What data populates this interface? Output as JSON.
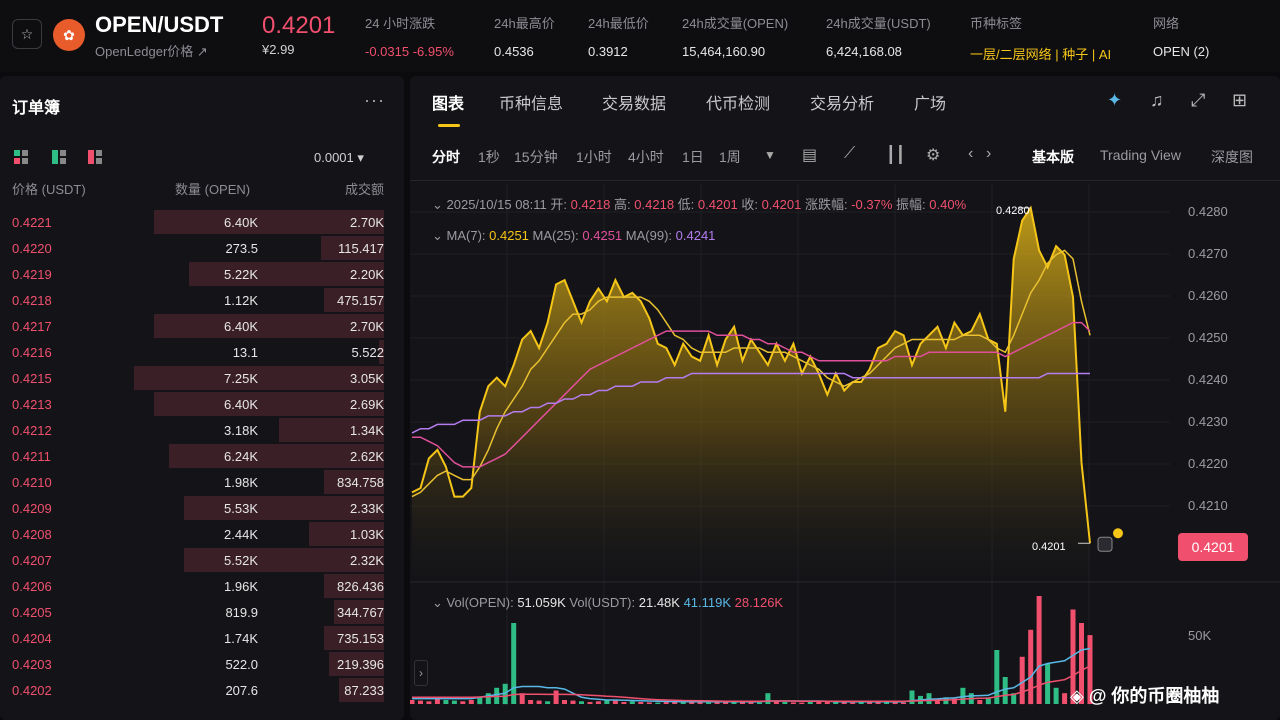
{
  "header": {
    "favorite_icon": "star-icon",
    "coin_icon": "openledger-logo-icon",
    "pair": "OPEN/USDT",
    "coin_name": "OpenLedger价格 ↗",
    "last_price": "0.4201",
    "cny_price": "¥2.99",
    "stats": [
      {
        "label": "24 小时涨跌",
        "value": "-0.0315 -6.95%",
        "style": "red"
      },
      {
        "label": "24h最高价",
        "value": "0.4536",
        "style": ""
      },
      {
        "label": "24h最低价",
        "value": "0.3912",
        "style": ""
      },
      {
        "label": "24h成交量(OPEN)",
        "value": "15,464,160.90",
        "style": ""
      },
      {
        "label": "24h成交量(USDT)",
        "value": "6,424,168.08",
        "style": ""
      },
      {
        "label": "币种标签",
        "value": "一层/二层网络 | 种子 | AI",
        "style": "gold"
      },
      {
        "label": "网络",
        "value": "OPEN (2)",
        "style": ""
      }
    ]
  },
  "orderbook": {
    "title": "订单簿",
    "more_icon": "more-icon",
    "precision": "0.0001 ▾",
    "headers": {
      "price": "价格 (USDT)",
      "qty": "数量 (OPEN)",
      "total": "成交额"
    },
    "rows": [
      {
        "price": "0.4221",
        "qty": "6.40K",
        "total": "2.70K",
        "depth": 0.92
      },
      {
        "price": "0.4220",
        "qty": "273.5",
        "total": "115.417",
        "depth": 0.25
      },
      {
        "price": "0.4219",
        "qty": "5.22K",
        "total": "2.20K",
        "depth": 0.78
      },
      {
        "price": "0.4218",
        "qty": "1.12K",
        "total": "475.157",
        "depth": 0.24
      },
      {
        "price": "0.4217",
        "qty": "6.40K",
        "total": "2.70K",
        "depth": 0.92
      },
      {
        "price": "0.4216",
        "qty": "13.1",
        "total": "5.522",
        "depth": 0.02
      },
      {
        "price": "0.4215",
        "qty": "7.25K",
        "total": "3.05K",
        "depth": 1.0
      },
      {
        "price": "0.4213",
        "qty": "6.40K",
        "total": "2.69K",
        "depth": 0.92
      },
      {
        "price": "0.4212",
        "qty": "3.18K",
        "total": "1.34K",
        "depth": 0.42
      },
      {
        "price": "0.4211",
        "qty": "6.24K",
        "total": "2.62K",
        "depth": 0.86
      },
      {
        "price": "0.4210",
        "qty": "1.98K",
        "total": "834.758",
        "depth": 0.24
      },
      {
        "price": "0.4209",
        "qty": "5.53K",
        "total": "2.33K",
        "depth": 0.8
      },
      {
        "price": "0.4208",
        "qty": "2.44K",
        "total": "1.03K",
        "depth": 0.3
      },
      {
        "price": "0.4207",
        "qty": "5.52K",
        "total": "2.32K",
        "depth": 0.8
      },
      {
        "price": "0.4206",
        "qty": "1.96K",
        "total": "826.436",
        "depth": 0.24
      },
      {
        "price": "0.4205",
        "qty": "819.9",
        "total": "344.767",
        "depth": 0.2
      },
      {
        "price": "0.4204",
        "qty": "1.74K",
        "total": "735.153",
        "depth": 0.24
      },
      {
        "price": "0.4203",
        "qty": "522.0",
        "total": "219.396",
        "depth": 0.22
      },
      {
        "price": "0.4202",
        "qty": "207.6",
        "total": "87.233",
        "depth": 0.18
      }
    ]
  },
  "tabs": [
    {
      "label": "图表",
      "active": true
    },
    {
      "label": "币种信息",
      "active": false
    },
    {
      "label": "交易数据",
      "active": false
    },
    {
      "label": "代币检测",
      "active": false
    },
    {
      "label": "交易分析",
      "active": false
    },
    {
      "label": "广场",
      "active": false
    }
  ],
  "tab_icons": [
    "sparkle-icon",
    "bell-icon",
    "expand-icon",
    "grid-icon"
  ],
  "intervals": [
    {
      "label": "分时",
      "active": true
    },
    {
      "label": "1秒",
      "active": false
    },
    {
      "label": "15分钟",
      "active": false
    },
    {
      "label": "1小时",
      "active": false
    },
    {
      "label": "4小时",
      "active": false
    },
    {
      "label": "1日",
      "active": false
    },
    {
      "label": "1周",
      "active": false
    }
  ],
  "tools": [
    "dropdown-icon",
    "calendar-icon",
    "indicator-icon",
    "candle-icon",
    "settings-icon",
    "prev-icon",
    "next-icon"
  ],
  "views": [
    {
      "label": "基本版",
      "active": true
    },
    {
      "label": "Trading View",
      "active": false
    },
    {
      "label": "深度图",
      "active": false
    }
  ],
  "ohlc": {
    "date": "2025/10/15 08:11",
    "open_label": "开:",
    "open": "0.4218",
    "high_label": "高:",
    "high": "0.4218",
    "low_label": "低:",
    "low": "0.4201",
    "close_label": "收:",
    "close": "0.4201",
    "chg_label": "涨跌幅:",
    "chg": "-0.37%",
    "amp_label": "振幅:",
    "amp": "0.40%"
  },
  "ma": {
    "ma7_label": "MA(7):",
    "ma7": "0.4251",
    "ma25_label": "MA(25):",
    "ma25": "0.4251",
    "ma99_label": "MA(99):",
    "ma99": "0.4241"
  },
  "vol": {
    "open_label": "Vol(OPEN):",
    "open": "51.059K",
    "usdt_label": "Vol(USDT):",
    "usdt": "21.48K",
    "ma1": "41.119K",
    "ma2": "28.126K"
  },
  "colors": {
    "accent": "#f5c518",
    "down": "#f0506e",
    "up": "#2ebd85",
    "ma25": "#e0509a",
    "ma99": "#b57cf0",
    "volma": "#5ab8e6"
  },
  "chart_data": {
    "type": "area",
    "ylim": [
      0.4198,
      0.4284
    ],
    "yticks": [
      "0.4280",
      "0.4270",
      "0.4260",
      "0.4250",
      "0.4240",
      "0.4230",
      "0.4220",
      "0.4210"
    ],
    "current_price": "0.4201",
    "high_marker": "0.4280",
    "low_marker": "0.4201",
    "series": [
      {
        "values": [
          0.4213,
          0.4214,
          0.4221,
          0.4223,
          0.4219,
          0.4212,
          0.4212,
          0.4214,
          0.4232,
          0.4238,
          0.424,
          0.4238,
          0.4243,
          0.4249,
          0.4251,
          0.4247,
          0.4253,
          0.4262,
          0.4263,
          0.4258,
          0.4253,
          0.4258,
          0.4261,
          0.4258,
          0.4263,
          0.4259,
          0.426,
          0.4258,
          0.4254,
          0.4248,
          0.4247,
          0.4243,
          0.4248,
          0.4245,
          0.4244,
          0.425,
          0.4243,
          0.4249,
          0.4252,
          0.4244,
          0.4249,
          0.4246,
          0.4243,
          0.4248,
          0.4244,
          0.4248,
          0.4241,
          0.4245,
          0.4241,
          0.4236,
          0.4241,
          0.4237,
          0.4239,
          0.4239,
          0.4242,
          0.4247,
          0.4248,
          0.4251,
          0.425,
          0.4243,
          0.4248,
          0.425,
          0.4252,
          0.4247,
          0.4253,
          0.425,
          0.4251,
          0.4255,
          0.4249,
          0.4248,
          0.4232,
          0.4268,
          0.4277,
          0.428,
          0.427,
          0.4266,
          0.4271,
          0.4269,
          0.4259,
          0.422,
          0.4201
        ]
      }
    ],
    "ma7": [
      0.4212,
      0.4213,
      0.4215,
      0.4217,
      0.4218,
      0.4217,
      0.4216,
      0.4216,
      0.4219,
      0.4223,
      0.4228,
      0.4232,
      0.4235,
      0.4238,
      0.4242,
      0.4244,
      0.4247,
      0.425,
      0.4253,
      0.4255,
      0.4255,
      0.4256,
      0.4258,
      0.4259,
      0.4259,
      0.4259,
      0.4259,
      0.4259,
      0.4258,
      0.4256,
      0.4253,
      0.425,
      0.4249,
      0.4247,
      0.4246,
      0.4246,
      0.4246,
      0.4246,
      0.4247,
      0.4247,
      0.4247,
      0.4247,
      0.4246,
      0.4246,
      0.4246,
      0.4245,
      0.4244,
      0.4243,
      0.4242,
      0.424,
      0.4239,
      0.4238,
      0.4239,
      0.424,
      0.4241,
      0.4243,
      0.4245,
      0.4247,
      0.4248,
      0.4249,
      0.4249,
      0.4249,
      0.4249,
      0.4249,
      0.4249,
      0.425,
      0.425,
      0.425,
      0.4249,
      0.4247,
      0.4246,
      0.425,
      0.4255,
      0.426,
      0.4263,
      0.4267,
      0.4269,
      0.427,
      0.4268,
      0.4258,
      0.425
    ],
    "ma25": [
      0.4226,
      0.4226,
      0.4225,
      0.4224,
      0.4222,
      0.422,
      0.4219,
      0.4219,
      0.4219,
      0.422,
      0.4221,
      0.4222,
      0.4224,
      0.4226,
      0.4228,
      0.423,
      0.4232,
      0.4234,
      0.4236,
      0.4238,
      0.424,
      0.4242,
      0.4243,
      0.4244,
      0.4245,
      0.4246,
      0.4247,
      0.4248,
      0.4249,
      0.425,
      0.4251,
      0.4251,
      0.4251,
      0.4251,
      0.4251,
      0.4251,
      0.425,
      0.425,
      0.425,
      0.425,
      0.4249,
      0.4249,
      0.4248,
      0.4248,
      0.4247,
      0.4246,
      0.4246,
      0.4245,
      0.4244,
      0.4244,
      0.4244,
      0.4244,
      0.4244,
      0.4244,
      0.4244,
      0.4244,
      0.4244,
      0.4245,
      0.4245,
      0.4245,
      0.4245,
      0.4246,
      0.4246,
      0.4246,
      0.4246,
      0.4246,
      0.4246,
      0.4246,
      0.4246,
      0.4246,
      0.4245,
      0.4246,
      0.4247,
      0.4248,
      0.4249,
      0.425,
      0.4251,
      0.4252,
      0.4253,
      0.4253,
      0.4251
    ],
    "ma99": [
      0.4227,
      0.4228,
      0.4228,
      0.4229,
      0.4229,
      0.4229,
      0.423,
      0.423,
      0.423,
      0.4231,
      0.4231,
      0.4231,
      0.4232,
      0.4232,
      0.4233,
      0.4233,
      0.4234,
      0.4234,
      0.4235,
      0.4235,
      0.4236,
      0.4236,
      0.4237,
      0.4237,
      0.4238,
      0.4238,
      0.4238,
      0.4239,
      0.4239,
      0.4239,
      0.424,
      0.424,
      0.424,
      0.4241,
      0.4241,
      0.4241,
      0.4241,
      0.4241,
      0.4241,
      0.4241,
      0.4241,
      0.4241,
      0.4241,
      0.4241,
      0.4241,
      0.4241,
      0.4241,
      0.4241,
      0.4241,
      0.4241,
      0.4241,
      0.4241,
      0.424,
      0.424,
      0.424,
      0.424,
      0.424,
      0.424,
      0.424,
      0.424,
      0.424,
      0.424,
      0.424,
      0.424,
      0.424,
      0.424,
      0.424,
      0.424,
      0.424,
      0.424,
      0.424,
      0.424,
      0.424,
      0.424,
      0.424,
      0.4241,
      0.4241,
      0.4241,
      0.4241,
      0.4241,
      0.4241
    ]
  },
  "volume_data": {
    "type": "bar",
    "ylim": [
      0,
      80000
    ],
    "ytick": "50K",
    "values": [
      3000,
      2500,
      2000,
      4000,
      3000,
      2500,
      2000,
      3000,
      5000,
      8000,
      12000,
      15000,
      60000,
      8000,
      3000,
      2500,
      2000,
      10000,
      3000,
      2500,
      2000,
      1500,
      2000,
      3000,
      2500,
      1500,
      2000,
      1500,
      1200,
      1000,
      1500,
      2000,
      1800,
      1500,
      1200,
      1000,
      1500,
      2000,
      1800,
      1500,
      1200,
      1000,
      8000,
      2000,
      1500,
      1200,
      1000,
      1500,
      2000,
      1800,
      1500,
      1200,
      1000,
      1500,
      2000,
      1800,
      1500,
      1200,
      1000,
      10000,
      6000,
      8000,
      3000,
      5000,
      4000,
      12000,
      8000,
      3000,
      5000,
      40000,
      20000,
      8000,
      35000,
      55000,
      80000,
      30000,
      12000,
      8000,
      70000,
      60000,
      51000
    ],
    "up": [
      0,
      0,
      0,
      0,
      1,
      1,
      0,
      0,
      1,
      1,
      1,
      1,
      1,
      0,
      0,
      0,
      1,
      0,
      0,
      0,
      1,
      0,
      0,
      1,
      0,
      0,
      1,
      0,
      0,
      1,
      0,
      0,
      1,
      0,
      0,
      1,
      0,
      0,
      1,
      0,
      0,
      1,
      1,
      0,
      1,
      0,
      0,
      1,
      0,
      0,
      1,
      0,
      0,
      1,
      0,
      0,
      1,
      0,
      0,
      1,
      1,
      1,
      0,
      1,
      0,
      1,
      1,
      0,
      1,
      1,
      1,
      1,
      0,
      0,
      0,
      1,
      1,
      0,
      0,
      0,
      0
    ],
    "ma1": [
      4000,
      4000,
      4000,
      4000,
      4000,
      4000,
      4000,
      4000,
      5000,
      6000,
      7000,
      8000,
      12000,
      13000,
      13000,
      13000,
      12000,
      12000,
      11000,
      8000,
      5000,
      4000,
      3500,
      3000,
      3000,
      2800,
      2600,
      2400,
      2200,
      2000,
      1900,
      1800,
      1800,
      1700,
      1600,
      1600,
      1600,
      1600,
      1600,
      1600,
      1600,
      1600,
      2200,
      2200,
      2200,
      2200,
      2200,
      2200,
      2200,
      2000,
      1800,
      1600,
      1600,
      1600,
      1600,
      1600,
      1600,
      1600,
      1600,
      2500,
      3000,
      3500,
      3800,
      4200,
      4500,
      5500,
      6000,
      6200,
      6500,
      9000,
      11000,
      12000,
      16000,
      20000,
      28000,
      30000,
      31000,
      32000,
      36000,
      40000,
      41119
    ],
    "ma2": [
      5000,
      5000,
      5000,
      5000,
      5000,
      5000,
      5000,
      5000,
      5200,
      5400,
      5600,
      5800,
      7000,
      7200,
      7200,
      7200,
      7100,
      7200,
      7100,
      7000,
      6800,
      6500,
      6200,
      5800,
      5500,
      5000,
      4500,
      4000,
      3500,
      3200,
      3000,
      2800,
      2600,
      2500,
      2400,
      2300,
      2200,
      2100,
      2000,
      2000,
      2000,
      2000,
      2200,
      2200,
      2200,
      2200,
      2100,
      2000,
      2000,
      2000,
      2000,
      2000,
      2000,
      2000,
      2000,
      2000,
      2000,
      2000,
      2000,
      2200,
      2400,
      2600,
      2800,
      3000,
      3200,
      3600,
      4000,
      4200,
      4400,
      5500,
      6500,
      7000,
      9000,
      11000,
      14000,
      16000,
      17000,
      18000,
      21000,
      25000,
      28126
    ]
  },
  "watermark": "◈ @ 你的币圈柚柚"
}
